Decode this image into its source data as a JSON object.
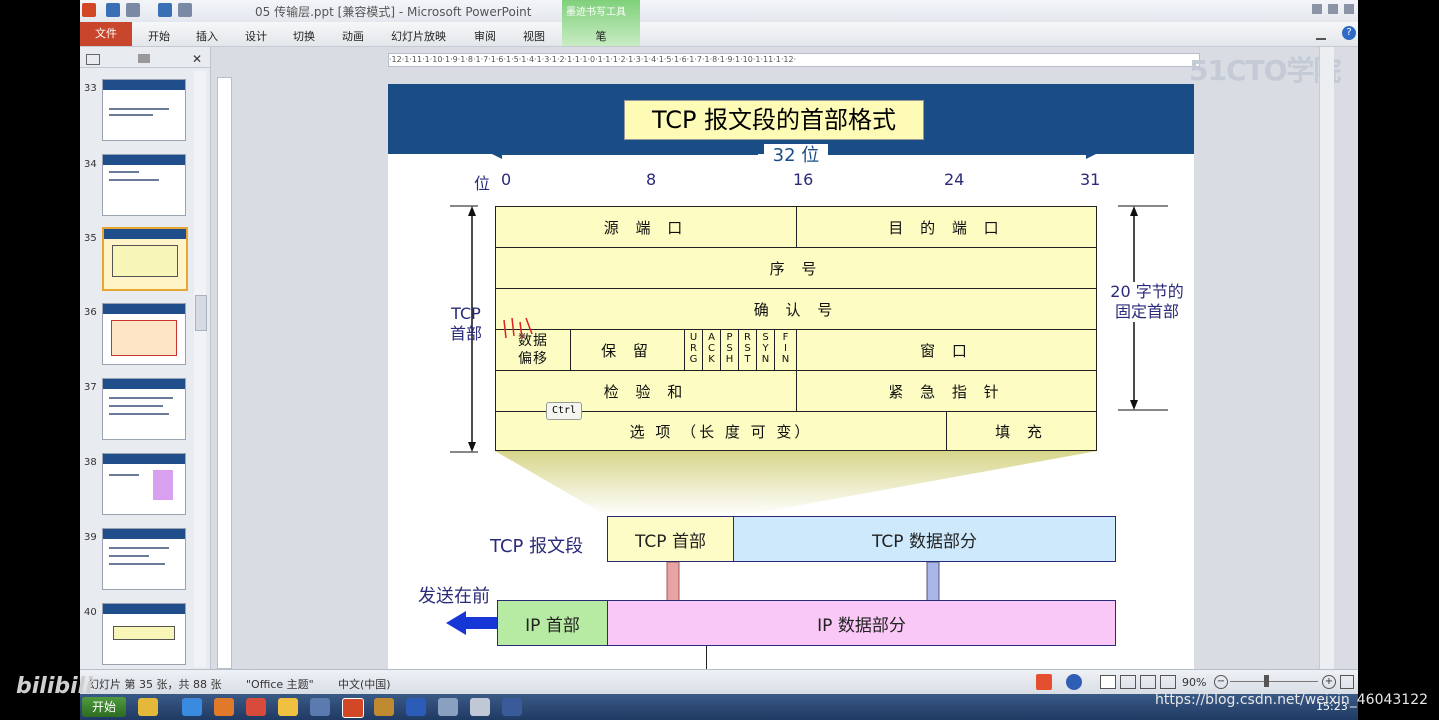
{
  "window": {
    "title": "05 传输层.ppt [兼容模式] - Microsoft PowerPoint",
    "context_tab_group": "墨迹书写工具",
    "context_tab": "笔"
  },
  "ribbon": {
    "file_label": "文件",
    "tabs": [
      "开始",
      "插入",
      "设计",
      "切换",
      "动画",
      "幻灯片放映",
      "审阅",
      "视图"
    ]
  },
  "ruler": {
    "text": "·12·1·11·1·10·1·9·1·8·1·7·1·6·1·5·1·4·1·3·1·2·1·1·1·0·1·1·1·2·1·3·1·4·1·5·1·6·1·7·1·8·1·9·1·10·1·11·1·12·"
  },
  "brand_watermark": "51CTO学院",
  "thumbnails": [
    {
      "num": "33"
    },
    {
      "num": "34"
    },
    {
      "num": "35"
    },
    {
      "num": "36"
    },
    {
      "num": "37"
    },
    {
      "num": "38"
    },
    {
      "num": "39"
    },
    {
      "num": "40"
    }
  ],
  "slide": {
    "title": "TCP 报文段的首部格式",
    "width_label": "32 位",
    "bit_label": "位",
    "bit_ticks": [
      "0",
      "8",
      "16",
      "24",
      "31"
    ],
    "left_label": "TCP\n首部",
    "right_label": "20 字节的\n固定首部",
    "rows": {
      "src_port": "源 端 口",
      "dst_port": "目 的 端 口",
      "seq": "序 号",
      "ack": "确 认 号",
      "offset": "数据\n偏移",
      "reserved": "保 留",
      "flags": [
        "URG",
        "ACK",
        "PSH",
        "RST",
        "SYN",
        "FIN"
      ],
      "window": "窗 口",
      "checksum": "检 验 和",
      "urgent": "紧 急 指 针",
      "options": "选 项 （长 度 可 变）",
      "padding": "填 充"
    },
    "tooltip": "Ctrl",
    "segment_label": "TCP 报文段",
    "tcp_header": "TCP 首部",
    "tcp_data": "TCP 数据部分",
    "send_first": "发送在前",
    "ip_header": "IP 首部",
    "ip_data": "IP 数据部分"
  },
  "status": {
    "slide_info": "幻灯片 第 35 张，共 88 张",
    "theme": "\"Office 主题\"",
    "language": "中文(中国)",
    "zoom": "90%"
  },
  "taskbar": {
    "start": "开始",
    "clock": "15:23"
  },
  "overlay": {
    "bilibili": "bilibili",
    "url_watermark": "https://blog.csdn.net/weixin_46043122"
  }
}
